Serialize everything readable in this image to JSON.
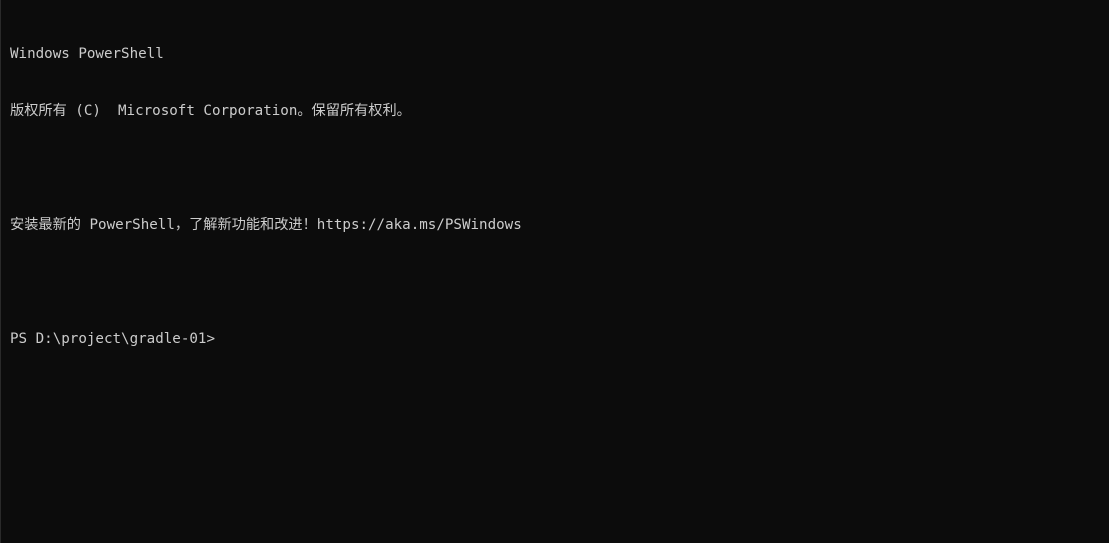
{
  "terminal": {
    "background": "#0c0c0c",
    "foreground": "#cccccc",
    "lines": [
      "Windows PowerShell",
      "版权所有 (C)  Microsoft Corporation。保留所有权利。",
      "",
      "安装最新的 PowerShell，了解新功能和改进！https://aka.ms/PSWindows",
      ""
    ],
    "prompt": "PS D:\\project\\gradle-01>"
  }
}
